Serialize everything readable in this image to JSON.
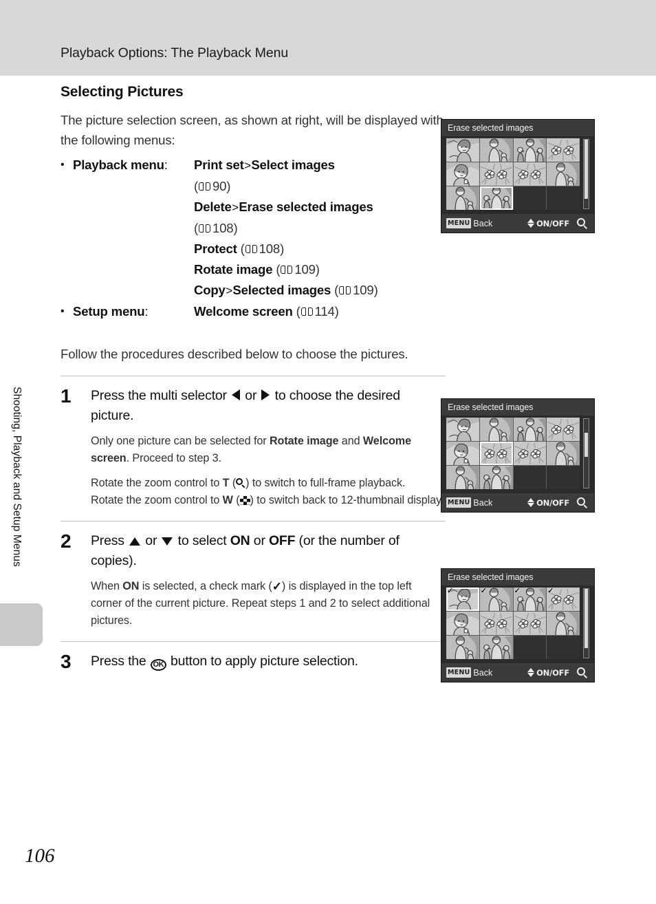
{
  "header": {
    "title": "Playback Options: The Playback Menu"
  },
  "sidebar": {
    "vertical_text": "Shooting, Playback and Setup Menus"
  },
  "section": {
    "heading": "Selecting Pictures",
    "intro": "The picture selection screen, as shown at right, will be displayed with the following menus:",
    "follow": "Follow the procedures described below to choose the pictures."
  },
  "menu_list": [
    {
      "category": "Playback menu",
      "colon": ":",
      "entries": [
        {
          "name_a": "Print set",
          "sep": ">",
          "name_b": "Select images",
          "page": "90"
        },
        {
          "name_a": "Delete",
          "sep": ">",
          "name_b": "Erase selected images",
          "page": "108"
        },
        {
          "name_a": "Protect",
          "sep": "",
          "name_b": "",
          "page": "108"
        },
        {
          "name_a": "Rotate image",
          "sep": "",
          "name_b": "",
          "page": "109"
        },
        {
          "name_a": "Copy",
          "sep": ">",
          "name_b": "Selected images",
          "page": "109"
        }
      ]
    },
    {
      "category": "Setup menu",
      "colon": ":",
      "entries": [
        {
          "name_a": "Welcome screen",
          "sep": "",
          "name_b": "",
          "page": "114"
        }
      ]
    }
  ],
  "steps": [
    {
      "number": "1",
      "title_pre": "Press the multi selector ",
      "title_mid": " or ",
      "title_post": " to choose the desired picture.",
      "sub1_pre": "Only one picture can be selected for ",
      "sub1_b1": "Rotate image",
      "sub1_mid": " and ",
      "sub1_b2": "Welcome screen",
      "sub1_post": ". Proceed to step 3.",
      "sub2_pre": "Rotate the zoom control to ",
      "sub2_key1": "T",
      "sub2_mid": ") to switch to full-frame playback.",
      "sub3_pre": "Rotate the zoom control to ",
      "sub3_key2": "W",
      "sub3_post": ") to switch back to 12-thumbnail display."
    },
    {
      "number": "2",
      "title_pre": "Press ",
      "title_mid": " or ",
      "title_post": " to select ",
      "title_on": "ON",
      "title_or": " or ",
      "title_off": "OFF",
      "title_end": " (or the number of copies).",
      "sub_pre": "When ",
      "sub_on": "ON",
      "sub_mid": " is selected, a check mark (",
      "sub_post": ") is displayed in the top left corner of the current picture. Repeat steps 1 and 2 to select additional pictures."
    },
    {
      "number": "3",
      "title_pre": "Press the ",
      "title_post": " button to apply picture selection."
    }
  ],
  "camera_screens": [
    {
      "id": "screen-1",
      "title": "Erase selected images",
      "selected_index": 9,
      "checked": [],
      "scroll_top_pct": 0,
      "scroll_height_pct": 86,
      "bar": {
        "menu_badge": "MENU",
        "back_label": "Back",
        "onoff_label": "ON/OFF"
      }
    },
    {
      "id": "screen-2",
      "title": "Erase selected images",
      "selected_index": 5,
      "checked": [],
      "scroll_top_pct": 20,
      "scroll_height_pct": 35,
      "bar": {
        "menu_badge": "MENU",
        "back_label": "Back",
        "onoff_label": "ON/OFF"
      }
    },
    {
      "id": "screen-3",
      "title": "Erase selected images",
      "selected_index": 0,
      "checked": [
        0,
        1,
        2,
        3
      ],
      "scroll_top_pct": 0,
      "scroll_height_pct": 86,
      "bar": {
        "menu_badge": "MENU",
        "back_label": "Back",
        "onoff_label": "ON/OFF"
      }
    }
  ],
  "thumbnails": [
    "portrait-woman",
    "figure-with-child",
    "family-group",
    "flowers",
    "portrait-woman-2",
    "flowers",
    "flowers",
    "figure-with-child",
    "figure-with-child",
    "family-group",
    "empty",
    "empty"
  ],
  "footer": {
    "page_number": "106"
  },
  "icons": {
    "book": "book-icon",
    "magnifier": "magnifier-icon",
    "thumbnail_grid": "thumbnail-grid-icon",
    "check": "check-mark-icon",
    "ok": "OK",
    "tri_left": "triangle-left-icon",
    "tri_right": "triangle-right-icon",
    "tri_up": "triangle-up-icon",
    "tri_down": "triangle-down-icon"
  }
}
